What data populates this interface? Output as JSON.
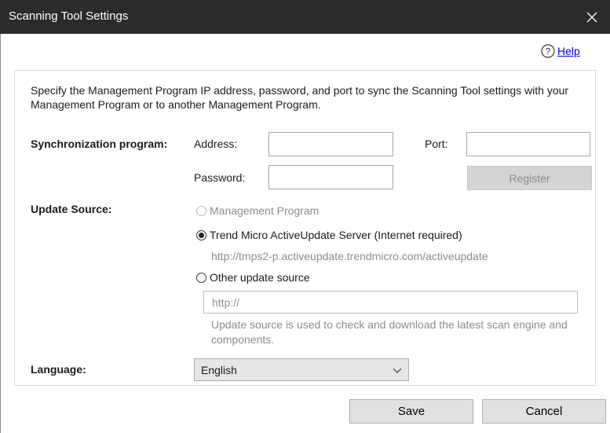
{
  "window": {
    "title": "Scanning Tool Settings"
  },
  "help": {
    "label": "Help"
  },
  "description": "Specify the Management Program IP address, password, and port to sync the Scanning Tool settings with your Management Program or to another Management Program.",
  "sync": {
    "section_label": "Synchronization program:",
    "address_label": "Address:",
    "address_value": "",
    "port_label": "Port:",
    "port_value": "",
    "password_label": "Password:",
    "password_value": "",
    "register_label": "Register"
  },
  "update_source": {
    "section_label": "Update Source:",
    "option_management": "Management Program",
    "option_trend": "Trend Micro ActiveUpdate Server (Internet required)",
    "trend_url": "http://tmps2-p.activeupdate.trendmicro.com/activeupdate",
    "option_other": "Other update source",
    "other_placeholder": "http://",
    "help_text": "Update source is used to check and download the latest scan engine and components.",
    "selected": "trend"
  },
  "language": {
    "label": "Language:",
    "selected": "English"
  },
  "buttons": {
    "save": "Save",
    "cancel": "Cancel"
  },
  "icons": {
    "help": "help-circle-icon",
    "close": "close-icon",
    "dropdown": "chevron-down-icon"
  }
}
